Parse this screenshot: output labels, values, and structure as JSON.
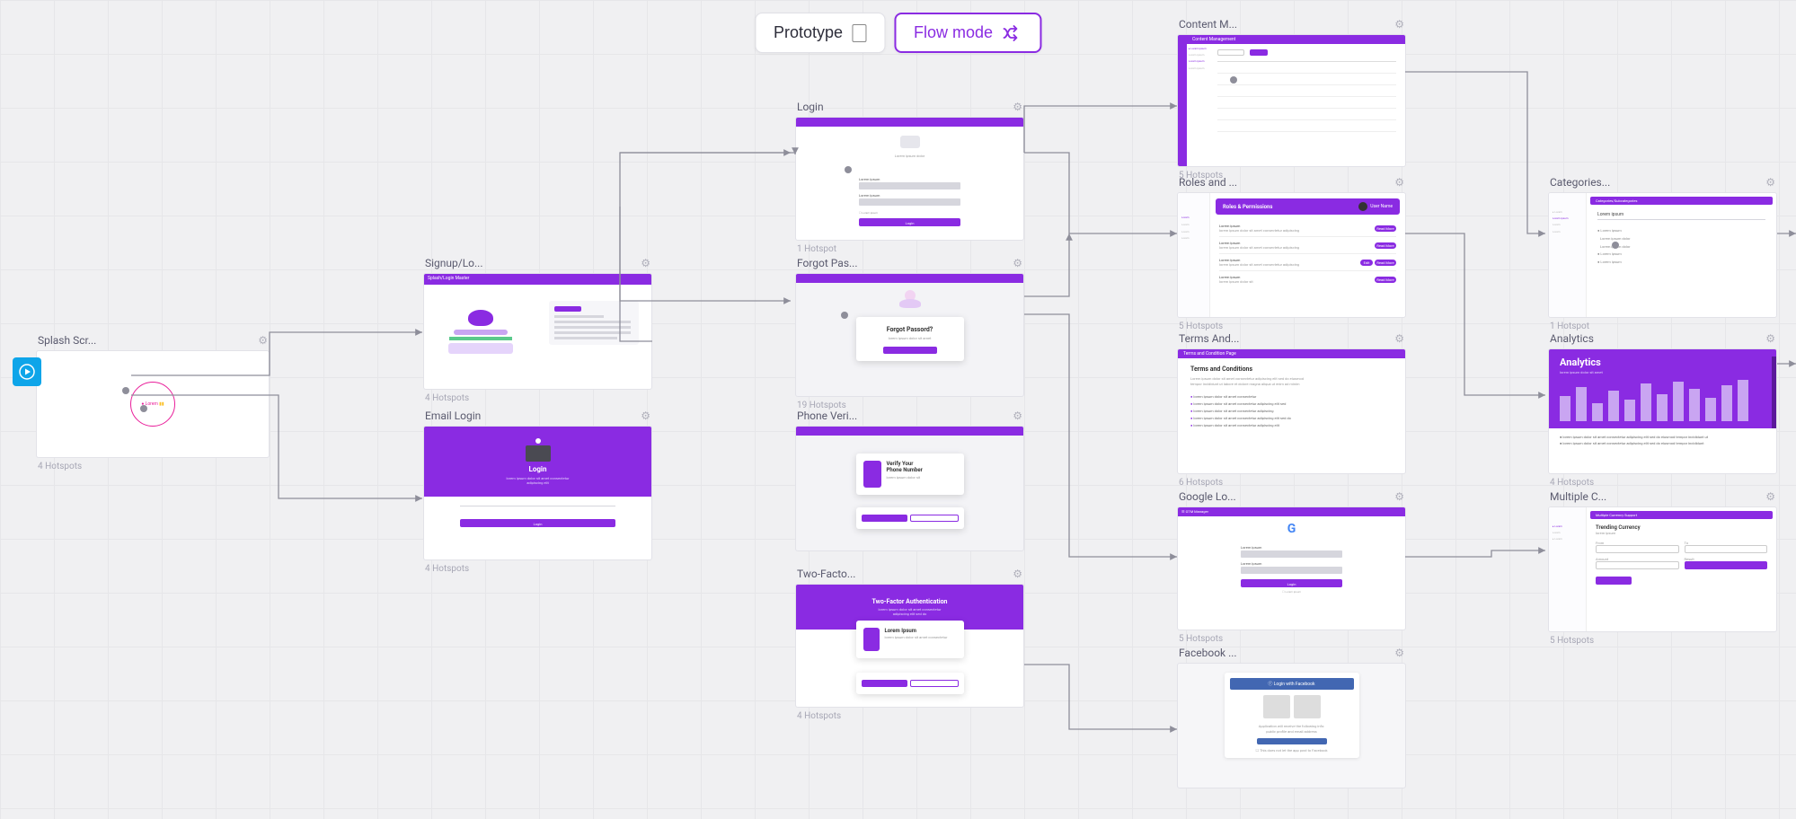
{
  "toolbar": {
    "prototype_label": "Prototype",
    "flow_label": "Flow mode"
  },
  "nodes": {
    "splash": {
      "title": "Splash Scr...",
      "footer": "4 Hotspots"
    },
    "signup": {
      "title": "Signup/Lo...",
      "footer": "4 Hotspots"
    },
    "emaillogin": {
      "title": "Email Login",
      "footer": "4 Hotspots",
      "heading": "Login",
      "btn": "Login"
    },
    "login": {
      "title": "Login",
      "footer": "1 Hotspot",
      "btn": "Login"
    },
    "forgot": {
      "title": "Forgot Pas...",
      "footer": "19 Hotspots",
      "card_title": "Forgot Passord?"
    },
    "phonever": {
      "title": "Phone Veri...",
      "footer": "",
      "card_title": "Verify Your",
      "card_sub": "Phone Number"
    },
    "twofactor": {
      "title": "Two-Facto...",
      "footer": "4 Hotspots",
      "header": "Two-Factor Authentication",
      "card_title": "Lorem Ipsum"
    },
    "content": {
      "title": "Content M...",
      "footer": "5 Hotspots"
    },
    "roles": {
      "title": "Roles and ...",
      "footer": "5 Hotspots",
      "header": "Roles & Permissions",
      "user": "User Name"
    },
    "terms": {
      "title": "Terms And...",
      "footer": "6 Hotspots",
      "header": "Terms and Condition Page",
      "card_title": "Terms and Conditions"
    },
    "google": {
      "title": "Google Lo...",
      "footer": "5 Hotspots",
      "btn": "Login"
    },
    "facebook": {
      "title": "Facebook ...",
      "footer": ""
    },
    "categories": {
      "title": "Categories...",
      "footer": "1 Hotspot"
    },
    "analytics": {
      "title": "Analytics",
      "footer": "4 Hotspots",
      "header": "Analytics"
    },
    "multiple": {
      "title": "Multiple C...",
      "footer": "5 Hotspots",
      "card_title": "Trending Currency"
    }
  }
}
